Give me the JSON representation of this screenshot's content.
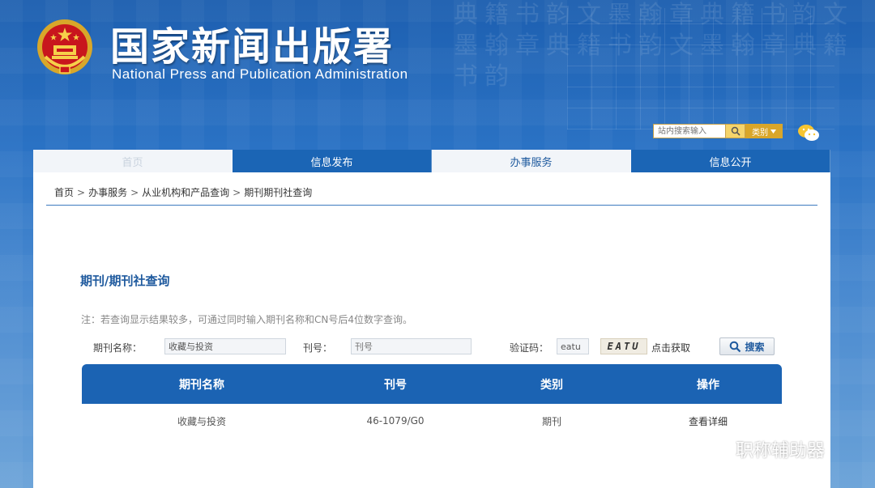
{
  "site": {
    "title": "国家新闻出版署",
    "subtitle": "National Press and Publication Administration"
  },
  "header_search": {
    "placeholder": "站内搜索输入",
    "category_label": "类别"
  },
  "nav": {
    "items": [
      {
        "label": "首页"
      },
      {
        "label": "信息发布"
      },
      {
        "label": "办事服务"
      },
      {
        "label": "信息公开"
      }
    ]
  },
  "breadcrumb": {
    "items": [
      "首页",
      "办事服务",
      "从业机构和产品查询",
      "期刊期刊社查询"
    ],
    "separator": ">"
  },
  "query": {
    "title": "期刊/期刊社查询",
    "notice": "注：若查询显示结果较多，可通过同时输入期刊名称和CN号后4位数字查询。",
    "name_label": "期刊名称：",
    "name_value": "收藏与投资",
    "issn_label": "刊号：",
    "issn_placeholder": "刊号",
    "captcha_label": "验证码：",
    "captcha_value": "eatu",
    "captcha_image_text": "EATU",
    "captcha_refresh": "点击获取",
    "search_label": "搜索"
  },
  "results": {
    "headers": [
      "期刊名称",
      "刊号",
      "类别",
      "操作"
    ],
    "rows": [
      {
        "name": "收藏与投资",
        "cn": "46-1079/G0",
        "type": "期刊",
        "action": "查看详细"
      }
    ]
  },
  "watermark": {
    "text": "职称辅助器"
  },
  "colors": {
    "brand_blue": "#1b63b3",
    "accent_gold": "#d9a62a"
  }
}
